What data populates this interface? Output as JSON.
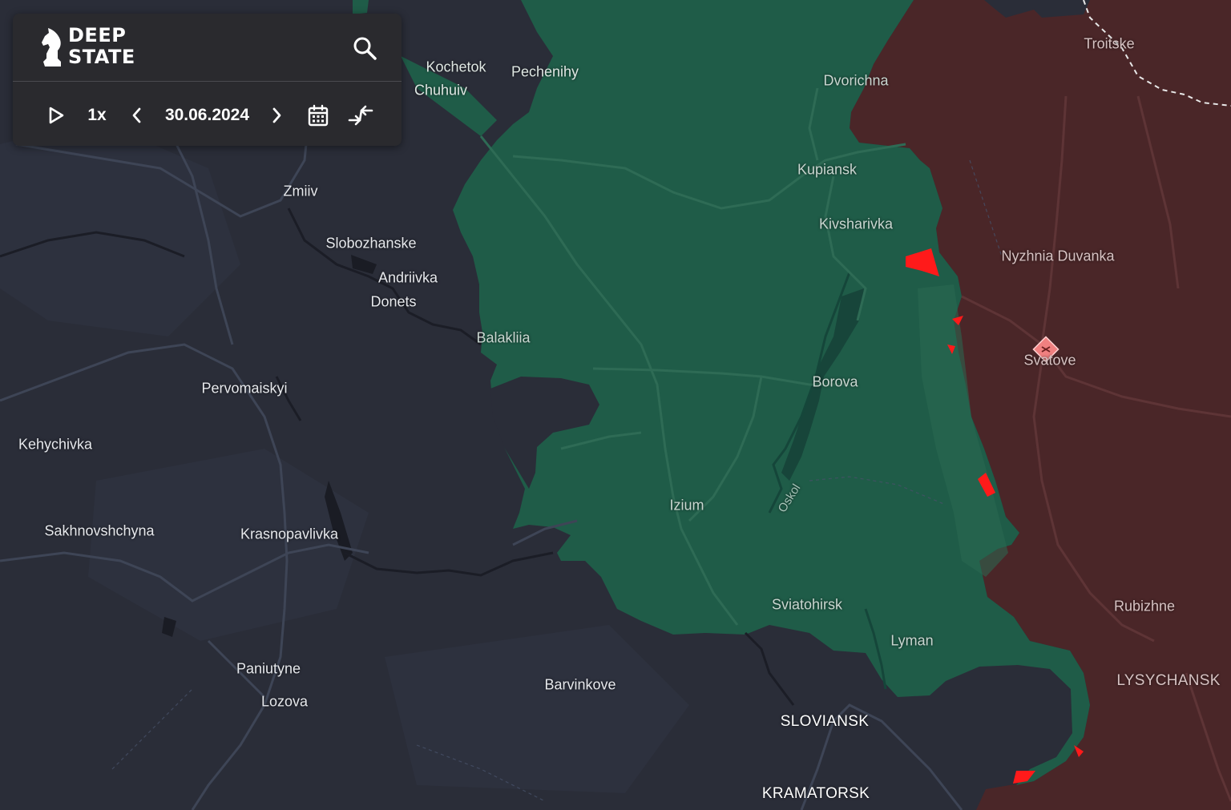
{
  "app": {
    "logo_line1": "DEEP",
    "logo_line2": "STATE"
  },
  "playback": {
    "speed": "1x",
    "date": "30.06.2024"
  },
  "icons": {
    "search": "search-icon",
    "play": "play-icon",
    "previous": "chevron-left-icon",
    "next": "chevron-right-icon",
    "calendar": "calendar-icon",
    "compare": "compare-arrows-icon",
    "marker": "airfield-marker-icon"
  },
  "colors": {
    "background": "#2a2d38",
    "ukraine_controlled": "#1f5c48",
    "ukraine_controlled_light": "#2a6a52",
    "occupied": "#4a2628",
    "recent_advance": "#ff1a1a",
    "road": "#3e4556",
    "panel": "#2a2a2e",
    "label_dark_area": "#e6e8ec",
    "label_green_area": "#c9d6d0",
    "label_red_area": "#d6c2c2"
  },
  "labels": [
    {
      "id": "kochetok",
      "text": "Kochetok",
      "zone": "green",
      "kind": "town"
    },
    {
      "id": "chuhuiv",
      "text": "Chuhuiv",
      "zone": "green",
      "kind": "town"
    },
    {
      "id": "pechenihy",
      "text": "Pechenihy",
      "zone": "green",
      "kind": "town"
    },
    {
      "id": "dvorichna",
      "text": "Dvorichna",
      "zone": "green",
      "kind": "town"
    },
    {
      "id": "troitske",
      "text": "Troitske",
      "zone": "red",
      "kind": "town"
    },
    {
      "id": "zmiiv",
      "text": "Zmiiv",
      "zone": "dark",
      "kind": "town"
    },
    {
      "id": "kupiansk",
      "text": "Kupiansk",
      "zone": "green",
      "kind": "town"
    },
    {
      "id": "slobozhanske",
      "text": "Slobozhanske",
      "zone": "dark",
      "kind": "town"
    },
    {
      "id": "kivsharivka",
      "text": "Kivsharivka",
      "zone": "green",
      "kind": "town"
    },
    {
      "id": "nyzhnia-duvanka",
      "text": "Nyzhnia Duvanka",
      "zone": "red",
      "kind": "town"
    },
    {
      "id": "andriivka",
      "text": "Andriivka",
      "zone": "dark",
      "kind": "town"
    },
    {
      "id": "donets",
      "text": "Donets",
      "zone": "dark",
      "kind": "town"
    },
    {
      "id": "balakliia",
      "text": "Balakliia",
      "zone": "green",
      "kind": "town"
    },
    {
      "id": "svatove",
      "text": "Svatove",
      "zone": "red",
      "kind": "town"
    },
    {
      "id": "borova",
      "text": "Borova",
      "zone": "green",
      "kind": "town"
    },
    {
      "id": "pervomaiskyi",
      "text": "Pervomaiskyi",
      "zone": "dark",
      "kind": "town"
    },
    {
      "id": "kehychivka",
      "text": "Kehychivka",
      "zone": "dark",
      "kind": "town"
    },
    {
      "id": "oskol",
      "text": "Oskol",
      "zone": "green",
      "kind": "river"
    },
    {
      "id": "izium",
      "text": "Izium",
      "zone": "green",
      "kind": "town"
    },
    {
      "id": "sakhnovshchyna",
      "text": "Sakhnovshchyna",
      "zone": "dark",
      "kind": "town"
    },
    {
      "id": "krasnopavlivka",
      "text": "Krasnopavlivka",
      "zone": "dark",
      "kind": "town"
    },
    {
      "id": "sviatohirsk",
      "text": "Sviatohirsk",
      "zone": "green",
      "kind": "town"
    },
    {
      "id": "rubizhne",
      "text": "Rubizhne",
      "zone": "red",
      "kind": "town"
    },
    {
      "id": "lyman",
      "text": "Lyman",
      "zone": "green",
      "kind": "town"
    },
    {
      "id": "paniutyne",
      "text": "Paniutyne",
      "zone": "dark",
      "kind": "town"
    },
    {
      "id": "lysychansk",
      "text": "LYSYCHANSK",
      "zone": "red",
      "kind": "city"
    },
    {
      "id": "barvinkove",
      "text": "Barvinkove",
      "zone": "dark",
      "kind": "town"
    },
    {
      "id": "lozova",
      "text": "Lozova",
      "zone": "dark",
      "kind": "town"
    },
    {
      "id": "sloviansk",
      "text": "SLOVIANSK",
      "zone": "dark",
      "kind": "city"
    },
    {
      "id": "kramatorsk",
      "text": "KRAMATORSK",
      "zone": "dark",
      "kind": "city"
    }
  ]
}
